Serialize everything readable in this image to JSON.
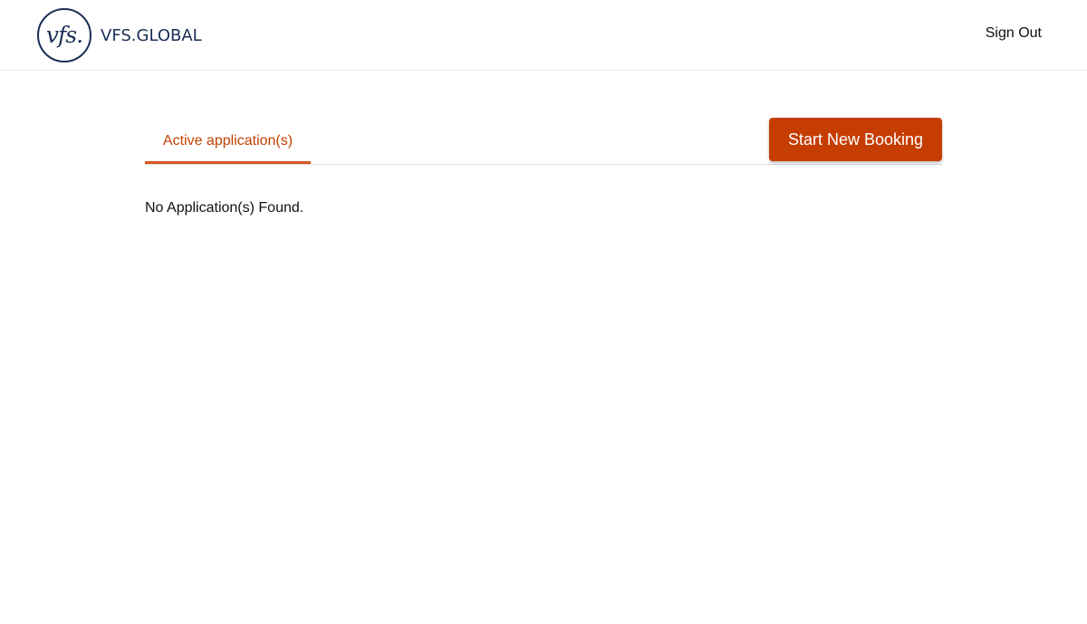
{
  "header": {
    "logo": {
      "mark": "vfs.",
      "wordmark": "VFS.GLOBAL",
      "color": "#1a2f55"
    },
    "sign_out_label": "Sign Out"
  },
  "main": {
    "tabs": [
      {
        "label": "Active application(s)",
        "active": true
      }
    ],
    "start_booking_label": "Start New Booking",
    "empty_message": "No Application(s) Found.",
    "accent_color": "#c53d00"
  }
}
